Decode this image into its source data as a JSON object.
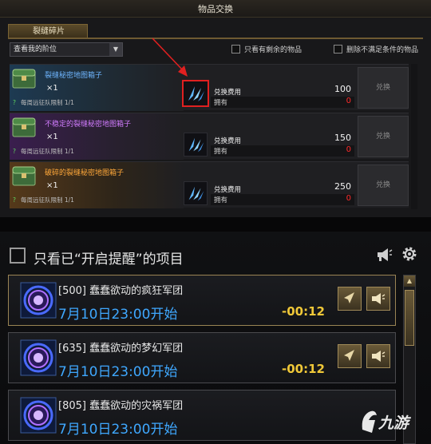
{
  "top_panel": {
    "title": "物品交换",
    "tab_label": "裂缝碎片",
    "filter_select": "查看我的阶位",
    "checkbox_remaining": "只看有剩余的物品",
    "checkbox_hide_unmet": "删除不满足条件的物品",
    "cost_label": "兑换费用",
    "own_label": "拥有",
    "exchange_label": "兑换",
    "items": [
      {
        "name": "裂缝秘密地图箱子",
        "qty": "×1",
        "limit": "每周远征队限制 1/1",
        "cost": "100",
        "owned": "0",
        "tier": "blue"
      },
      {
        "name": "不稳定的裂缝秘密地图箱子",
        "qty": "×1",
        "limit": "每周远征队限制 1/1",
        "cost": "150",
        "owned": "0",
        "tier": "purple"
      },
      {
        "name": "破碎的裂缝秘密地图箱子",
        "qty": "×1",
        "limit": "每周远征队限制 1/1",
        "cost": "250",
        "owned": "0",
        "tier": "orange"
      }
    ]
  },
  "bottom_panel": {
    "notify_label": "只看已“开启提醒”的项目",
    "events": [
      {
        "name": "[500] 蠢蠢欲动的疯狂军团",
        "time": "7月10日23:00开始",
        "countdown": "-00:12"
      },
      {
        "name": "[635] 蠢蠢欲动的梦幻军团",
        "time": "7月10日23:00开始",
        "countdown": "-00:12"
      },
      {
        "name": "[805] 蠢蠢欲动的灾祸军团",
        "time": "7月10日23:00开始",
        "countdown": ""
      }
    ]
  },
  "watermark": {
    "text": "九游"
  },
  "colors": {
    "accent_gold": "#9a8454",
    "time_blue": "#3fa8ff",
    "countdown_yellow": "#f0c838",
    "owned_red": "#ff2a2a"
  }
}
